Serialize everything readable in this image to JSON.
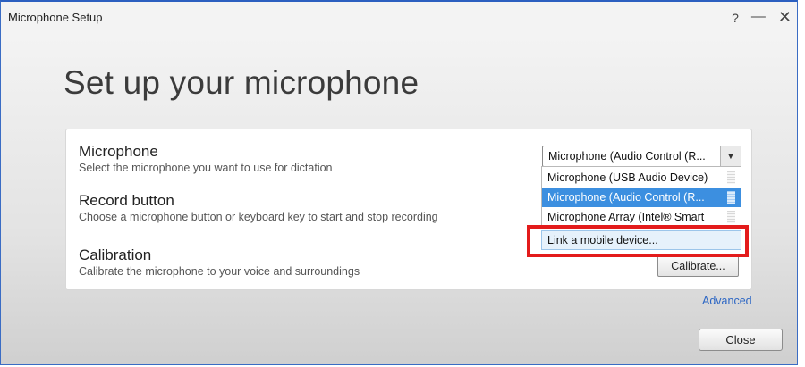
{
  "window": {
    "title": "Microphone Setup",
    "controls": {
      "help": "?",
      "minimize": "—",
      "close": "✕"
    }
  },
  "heading": "Set up your microphone",
  "sections": [
    {
      "name": "Microphone",
      "description": "Select the microphone you want to use for dictation"
    },
    {
      "name": "Record button",
      "description": "Choose a microphone button or keyboard key to start and stop recording"
    },
    {
      "name": "Calibration",
      "description": "Calibrate the microphone to your voice and surroundings"
    }
  ],
  "microphone_select": {
    "selected": "Microphone (Audio Control (R...",
    "options": [
      {
        "label": "Microphone (USB Audio Device)",
        "selected": false
      },
      {
        "label": "Microphone (Audio Control (R...",
        "selected": true
      },
      {
        "label": "Microphone Array (Intel® Smart",
        "selected": false
      },
      {
        "label": "Link a mobile device...",
        "selected": false,
        "highlighted": true
      }
    ]
  },
  "calibrate_button": "Calibrate...",
  "advanced_link": "Advanced",
  "close_button": "Close",
  "colors": {
    "selection": "#3c8fe0",
    "highlight_box": "#e31b1b",
    "link": "#2c66c4"
  }
}
